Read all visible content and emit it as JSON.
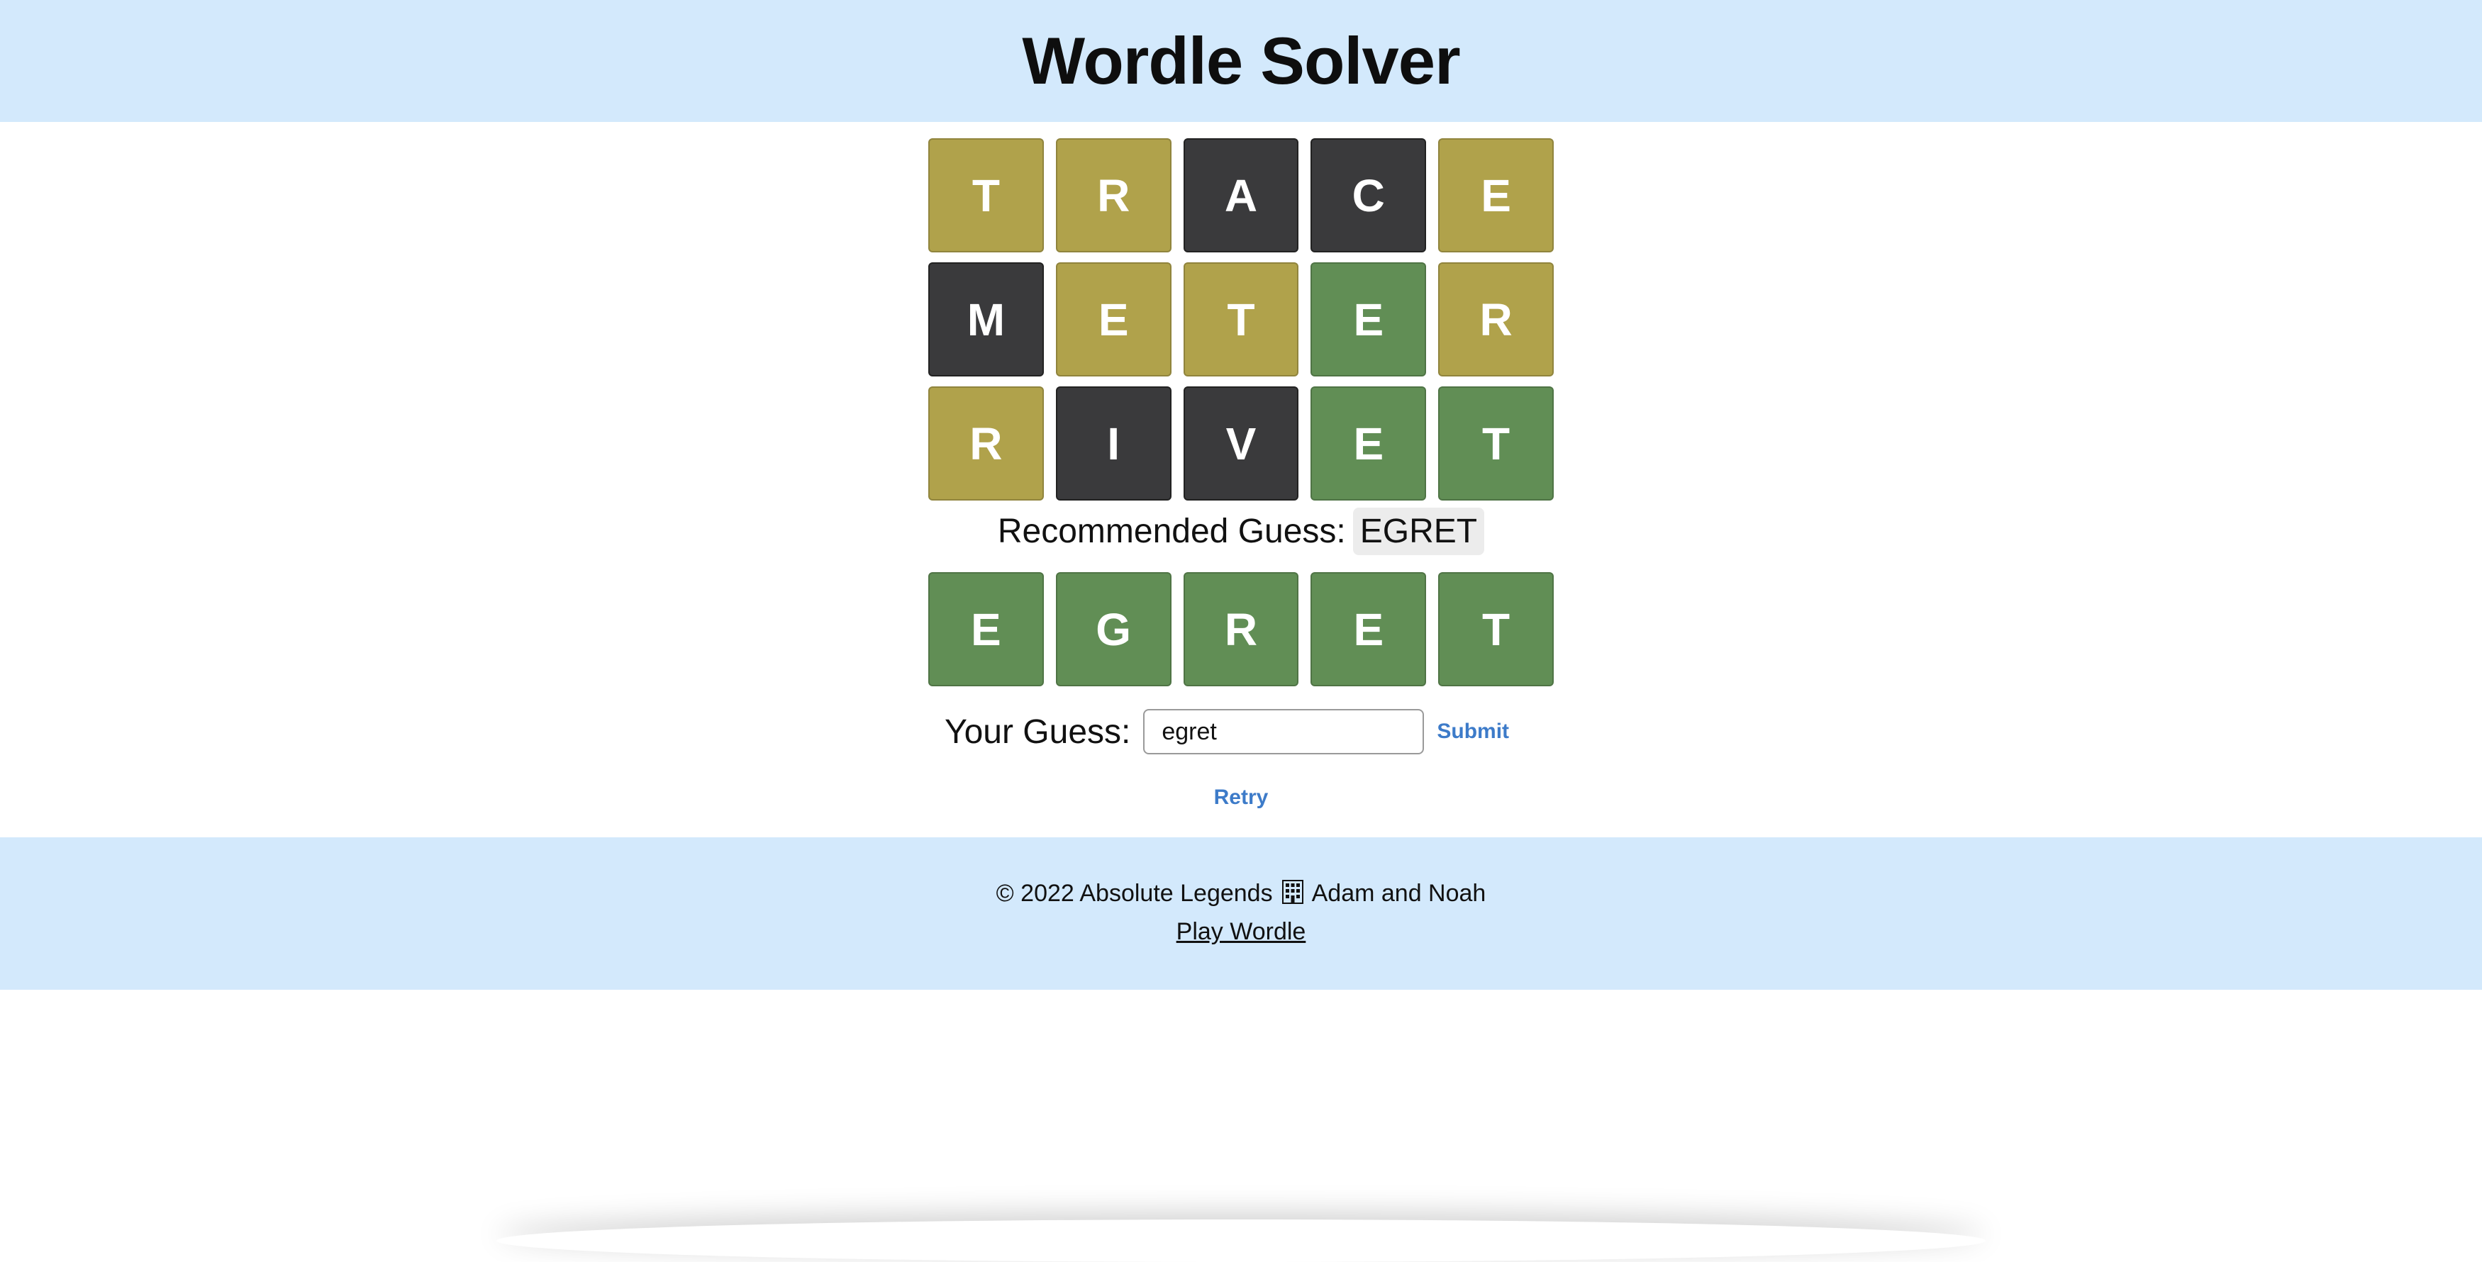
{
  "header": {
    "title": "Wordle Solver"
  },
  "board": {
    "rows": [
      [
        {
          "letter": "T",
          "state": "present"
        },
        {
          "letter": "R",
          "state": "present"
        },
        {
          "letter": "A",
          "state": "absent"
        },
        {
          "letter": "C",
          "state": "absent"
        },
        {
          "letter": "E",
          "state": "present"
        }
      ],
      [
        {
          "letter": "M",
          "state": "absent"
        },
        {
          "letter": "E",
          "state": "present"
        },
        {
          "letter": "T",
          "state": "present"
        },
        {
          "letter": "E",
          "state": "correct"
        },
        {
          "letter": "R",
          "state": "present"
        }
      ],
      [
        {
          "letter": "R",
          "state": "present"
        },
        {
          "letter": "I",
          "state": "absent"
        },
        {
          "letter": "V",
          "state": "absent"
        },
        {
          "letter": "E",
          "state": "correct"
        },
        {
          "letter": "T",
          "state": "correct"
        }
      ]
    ]
  },
  "recommendation": {
    "label": "Recommended Guess:",
    "word": "EGRET",
    "tiles": [
      {
        "letter": "E",
        "state": "correct"
      },
      {
        "letter": "G",
        "state": "correct"
      },
      {
        "letter": "R",
        "state": "correct"
      },
      {
        "letter": "E",
        "state": "correct"
      },
      {
        "letter": "T",
        "state": "correct"
      }
    ]
  },
  "guess": {
    "label": "Your Guess:",
    "value": "egret",
    "submit_label": "Submit"
  },
  "retry_label": "Retry",
  "footer": {
    "copyright_prefix": "© 2022 Absolute Legends",
    "copyright_suffix": "Adam and Noah",
    "link_text": "Play Wordle"
  },
  "colors": {
    "present": "#b0a24b",
    "absent": "#3a3a3c",
    "correct": "#618e55",
    "header_bg": "#d3e9fc",
    "link": "#3d7bc9"
  },
  "icons": {
    "footer_separator": "building-icon"
  }
}
